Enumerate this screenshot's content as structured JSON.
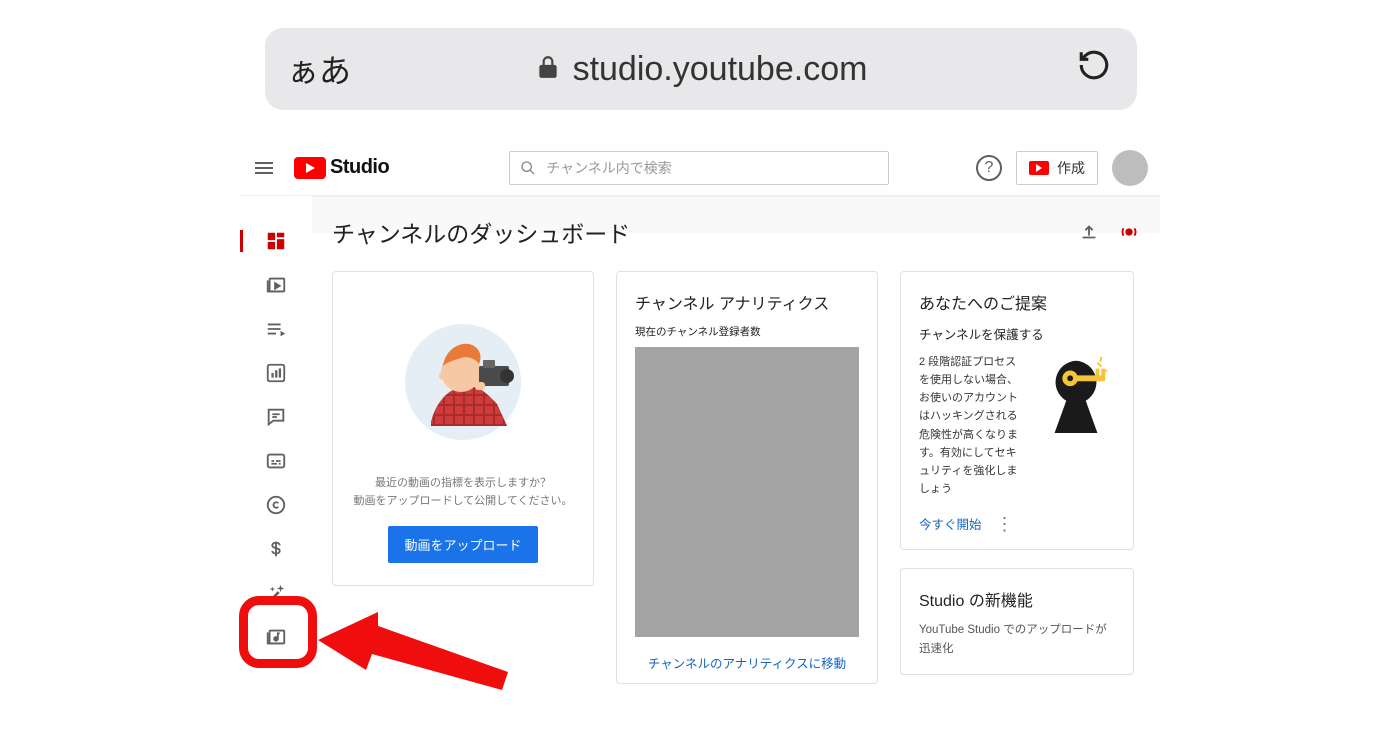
{
  "browser": {
    "text_mode": "ぁあ",
    "domain": "studio.youtube.com"
  },
  "header": {
    "brand": "Studio",
    "search_placeholder": "チャンネル内で検索",
    "create_label": "作成"
  },
  "page": {
    "title": "チャンネルのダッシュボード"
  },
  "upload_card": {
    "desc_line1": "最近の動画の指標を表示しますか？",
    "desc_line2": "動画をアップロードして公開してください。",
    "button": "動画をアップロード"
  },
  "analytics_card": {
    "title": "チャンネル アナリティクス",
    "sub": "現在のチャンネル登録者数",
    "link": "チャンネルのアナリティクスに移動"
  },
  "tip_card": {
    "title": "あなたへのご提案",
    "sub": "チャンネルを保護する",
    "desc": "2 段階認証プロセスを使用しない場合、お使いのアカウントはハッキングされる危険性が高くなります。有効にしてセキュリティを強化しましょう",
    "cta": "今すぐ開始"
  },
  "new_card": {
    "title": "Studio の新機能",
    "desc": "YouTube Studio でのアップロードが迅速化"
  }
}
